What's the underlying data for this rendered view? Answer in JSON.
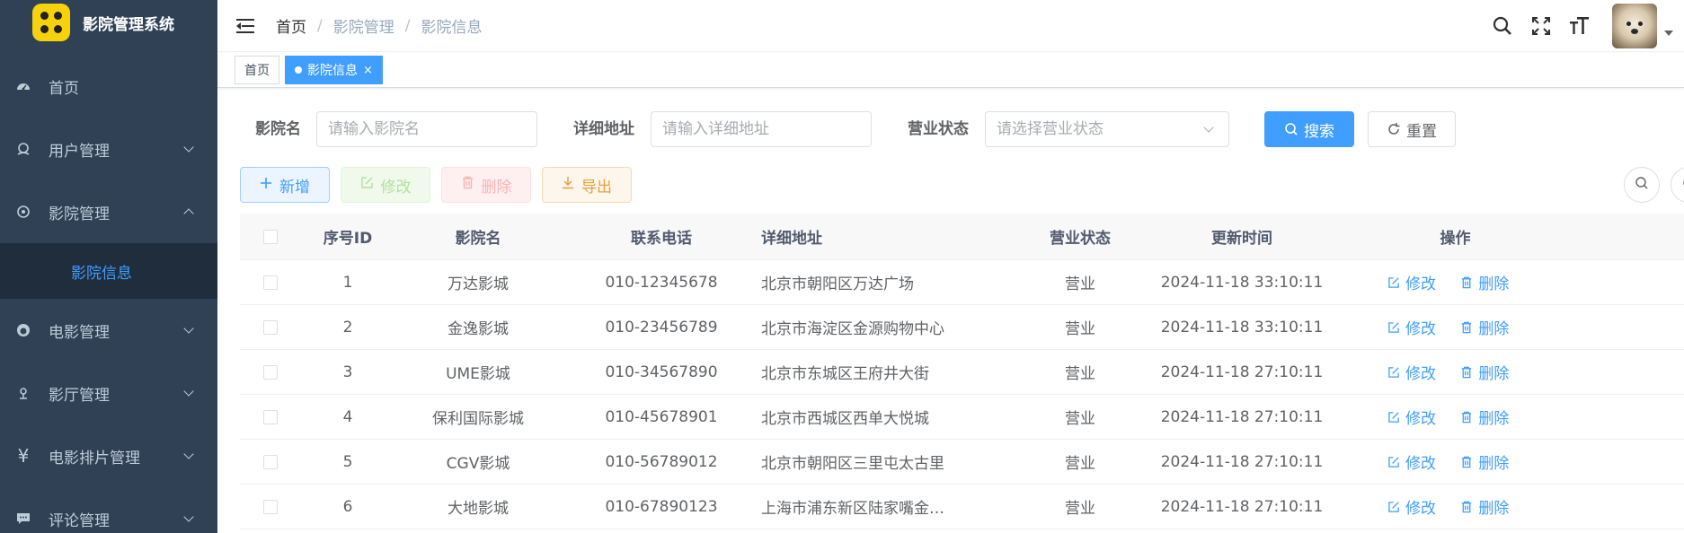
{
  "sidebar": {
    "title": "影院管理系统",
    "items": [
      {
        "label": "首页",
        "icon": "dashboard-icon"
      },
      {
        "label": "用户管理",
        "icon": "user-icon"
      },
      {
        "label": "影院管理",
        "icon": "cinema-icon",
        "expanded": true
      },
      {
        "label": "电影管理",
        "icon": "github-icon"
      },
      {
        "label": "影厅管理",
        "icon": "location-icon"
      },
      {
        "label": "电影排片管理",
        "icon": "yen-icon"
      },
      {
        "label": "评论管理",
        "icon": "message-icon"
      }
    ],
    "submenu": {
      "label": "影院信息"
    }
  },
  "breadcrumb": [
    "首页",
    "影院管理",
    "影院信息"
  ],
  "breadcrumb_sep": "/",
  "tags": [
    {
      "label": "首页",
      "active": false
    },
    {
      "label": "影院信息",
      "active": true,
      "close": "×"
    }
  ],
  "search": {
    "name_label": "影院名",
    "name_placeholder": "请输入影院名",
    "address_label": "详细地址",
    "address_placeholder": "请输入详细地址",
    "status_label": "营业状态",
    "status_placeholder": "请选择营业状态",
    "search_button": "搜索",
    "reset_button": "重置"
  },
  "toolbar": {
    "add": "新增",
    "edit": "修改",
    "delete": "删除",
    "export": "导出"
  },
  "table": {
    "headers": [
      "序号ID",
      "影院名",
      "联系电话",
      "详细地址",
      "营业状态",
      "更新时间",
      "操作"
    ],
    "edit_label": "修改",
    "delete_label": "删除",
    "rows": [
      {
        "id": "1",
        "name": "万达影城",
        "phone": "010-12345678",
        "address": "北京市朝阳区万达广场",
        "status": "营业",
        "updated": "2024-11-18 33:10:11"
      },
      {
        "id": "2",
        "name": "金逸影城",
        "phone": "010-23456789",
        "address": "北京市海淀区金源购物中心",
        "status": "营业",
        "updated": "2024-11-18 33:10:11"
      },
      {
        "id": "3",
        "name": "UME影城",
        "phone": "010-34567890",
        "address": "北京市东城区王府井大街",
        "status": "营业",
        "updated": "2024-11-18 27:10:11"
      },
      {
        "id": "4",
        "name": "保利国际影城",
        "phone": "010-45678901",
        "address": "北京市西城区西单大悦城",
        "status": "营业",
        "updated": "2024-11-18 27:10:11"
      },
      {
        "id": "5",
        "name": "CGV影城",
        "phone": "010-56789012",
        "address": "北京市朝阳区三里屯太古里",
        "status": "营业",
        "updated": "2024-11-18 27:10:11"
      },
      {
        "id": "6",
        "name": "大地影城",
        "phone": "010-67890123",
        "address": "上海市浦东新区陆家嘴金…",
        "status": "营业",
        "updated": "2024-11-18 27:10:11"
      }
    ]
  },
  "colors": {
    "sidebar_bg": "#304156",
    "primary": "#409eff",
    "brand_logo": "#f5d20a"
  }
}
